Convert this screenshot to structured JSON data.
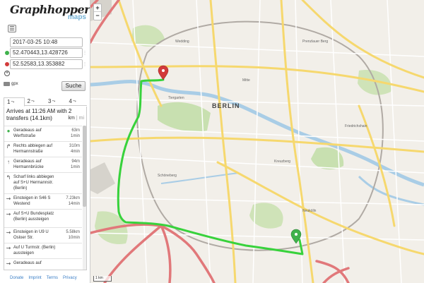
{
  "logo": {
    "main": "Graphhopper",
    "sub": "maps"
  },
  "layers_icon": "layers-icon",
  "inputs": {
    "time": "2017-03-25 10:48",
    "start": "52.470443,13.428726",
    "end": "52.52583,13.353882"
  },
  "colors": {
    "start": "#3fb24b",
    "end": "#d23a3a",
    "route": "#38d23c",
    "accent": "#74b2d6"
  },
  "gpx_label": "gpx",
  "search_label": "Suche",
  "tabs": [
    {
      "label": "1",
      "active": true
    },
    {
      "label": "2",
      "active": false
    },
    {
      "label": "3",
      "active": false
    },
    {
      "label": "4",
      "active": false
    }
  ],
  "summary": "Arrives at 11:26 AM with 2 transfers (14.1km)",
  "units": {
    "km": "km",
    "sep": "|",
    "mi": "mi"
  },
  "instructions": [
    {
      "icon": "marker-icon",
      "text": "Geradeaus auf Werftstraße",
      "dist": "63m",
      "time": "1min"
    },
    {
      "icon": "turn-right-icon",
      "text": "Rechts abbiegen auf Hermannstraße",
      "dist": "310m",
      "time": "4min"
    },
    {
      "icon": "straight-icon",
      "text": "Geradeaus auf Hermannbrücke",
      "dist": "94m",
      "time": "1min"
    },
    {
      "icon": "turn-sharp-left-icon",
      "text": "Scharf links abbiegen auf S+U Hermannstr. (Berlin)",
      "dist": "",
      "time": ""
    },
    {
      "icon": "transit-icon",
      "text": "Einsteigen in S46 S Westend",
      "dist": "7.23km",
      "time": "14min"
    },
    {
      "icon": "transit-icon",
      "text": "Auf S+U Bundesplatz (Berlin) aussteigen",
      "dist": "",
      "time": ""
    },
    {
      "icon": "transit-icon",
      "text": "Einsteigen in U9 U Osloer Str.",
      "dist": "5.58km",
      "time": "10min"
    },
    {
      "icon": "transit-icon",
      "text": "Auf U Turmstr. (Berlin) aussteigen",
      "dist": "",
      "time": ""
    },
    {
      "icon": "transit-icon",
      "text": "Geradeaus auf",
      "dist": "",
      "time": ""
    }
  ],
  "footer": [
    "Donate",
    "Imprint",
    "Terms",
    "Privacy"
  ],
  "map": {
    "city": "BERLIN",
    "zoom_in": "+",
    "zoom_out": "−",
    "scale": "1 km",
    "district_labels": [
      "Mitte",
      "Prenzlauer Berg",
      "Kreuzberg",
      "Neukölln",
      "Schöneberg",
      "Tiergarten",
      "Friedrichshain",
      "Wedding"
    ]
  }
}
